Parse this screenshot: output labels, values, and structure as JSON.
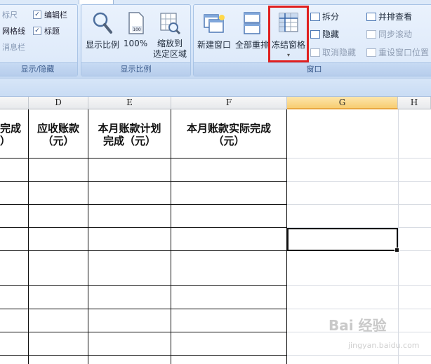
{
  "ribbon": {
    "show_group": {
      "ruler": "标尺",
      "formula_bar": "编辑栏",
      "gridlines": "网格线",
      "headings": "标题",
      "message_bar": "消息栏",
      "label": "显示/隐藏"
    },
    "zoom_group": {
      "zoom": "显示比例",
      "hundred": "100%",
      "zoom_selection_line1": "缩放到",
      "zoom_selection_line2": "选定区域",
      "label": "显示比例"
    },
    "window_group": {
      "new_window": "新建窗口",
      "arrange_all": "全部重排",
      "freeze_panes": "冻结窗格",
      "split": "拆分",
      "hide": "隐藏",
      "unhide": "取消隐藏",
      "side_by_side": "并排查看",
      "sync_scroll": "同步滚动",
      "reset_position": "重设窗口位置",
      "label": "窗口"
    }
  },
  "sheet": {
    "columns": [
      "D",
      "E",
      "F",
      "G",
      "H"
    ],
    "headers": {
      "c_partial_line1": "完成",
      "c_partial_line2": "）",
      "d_line1": "应收账款",
      "d_line2": "（元）",
      "e_line1": "本月账款计划",
      "e_line2": "完成（元）",
      "f_line1": "本月账款实际完成",
      "f_line2": "（元）"
    }
  },
  "watermark": {
    "brand": "Bai 经验",
    "url": "jingyan.baidu.com"
  }
}
